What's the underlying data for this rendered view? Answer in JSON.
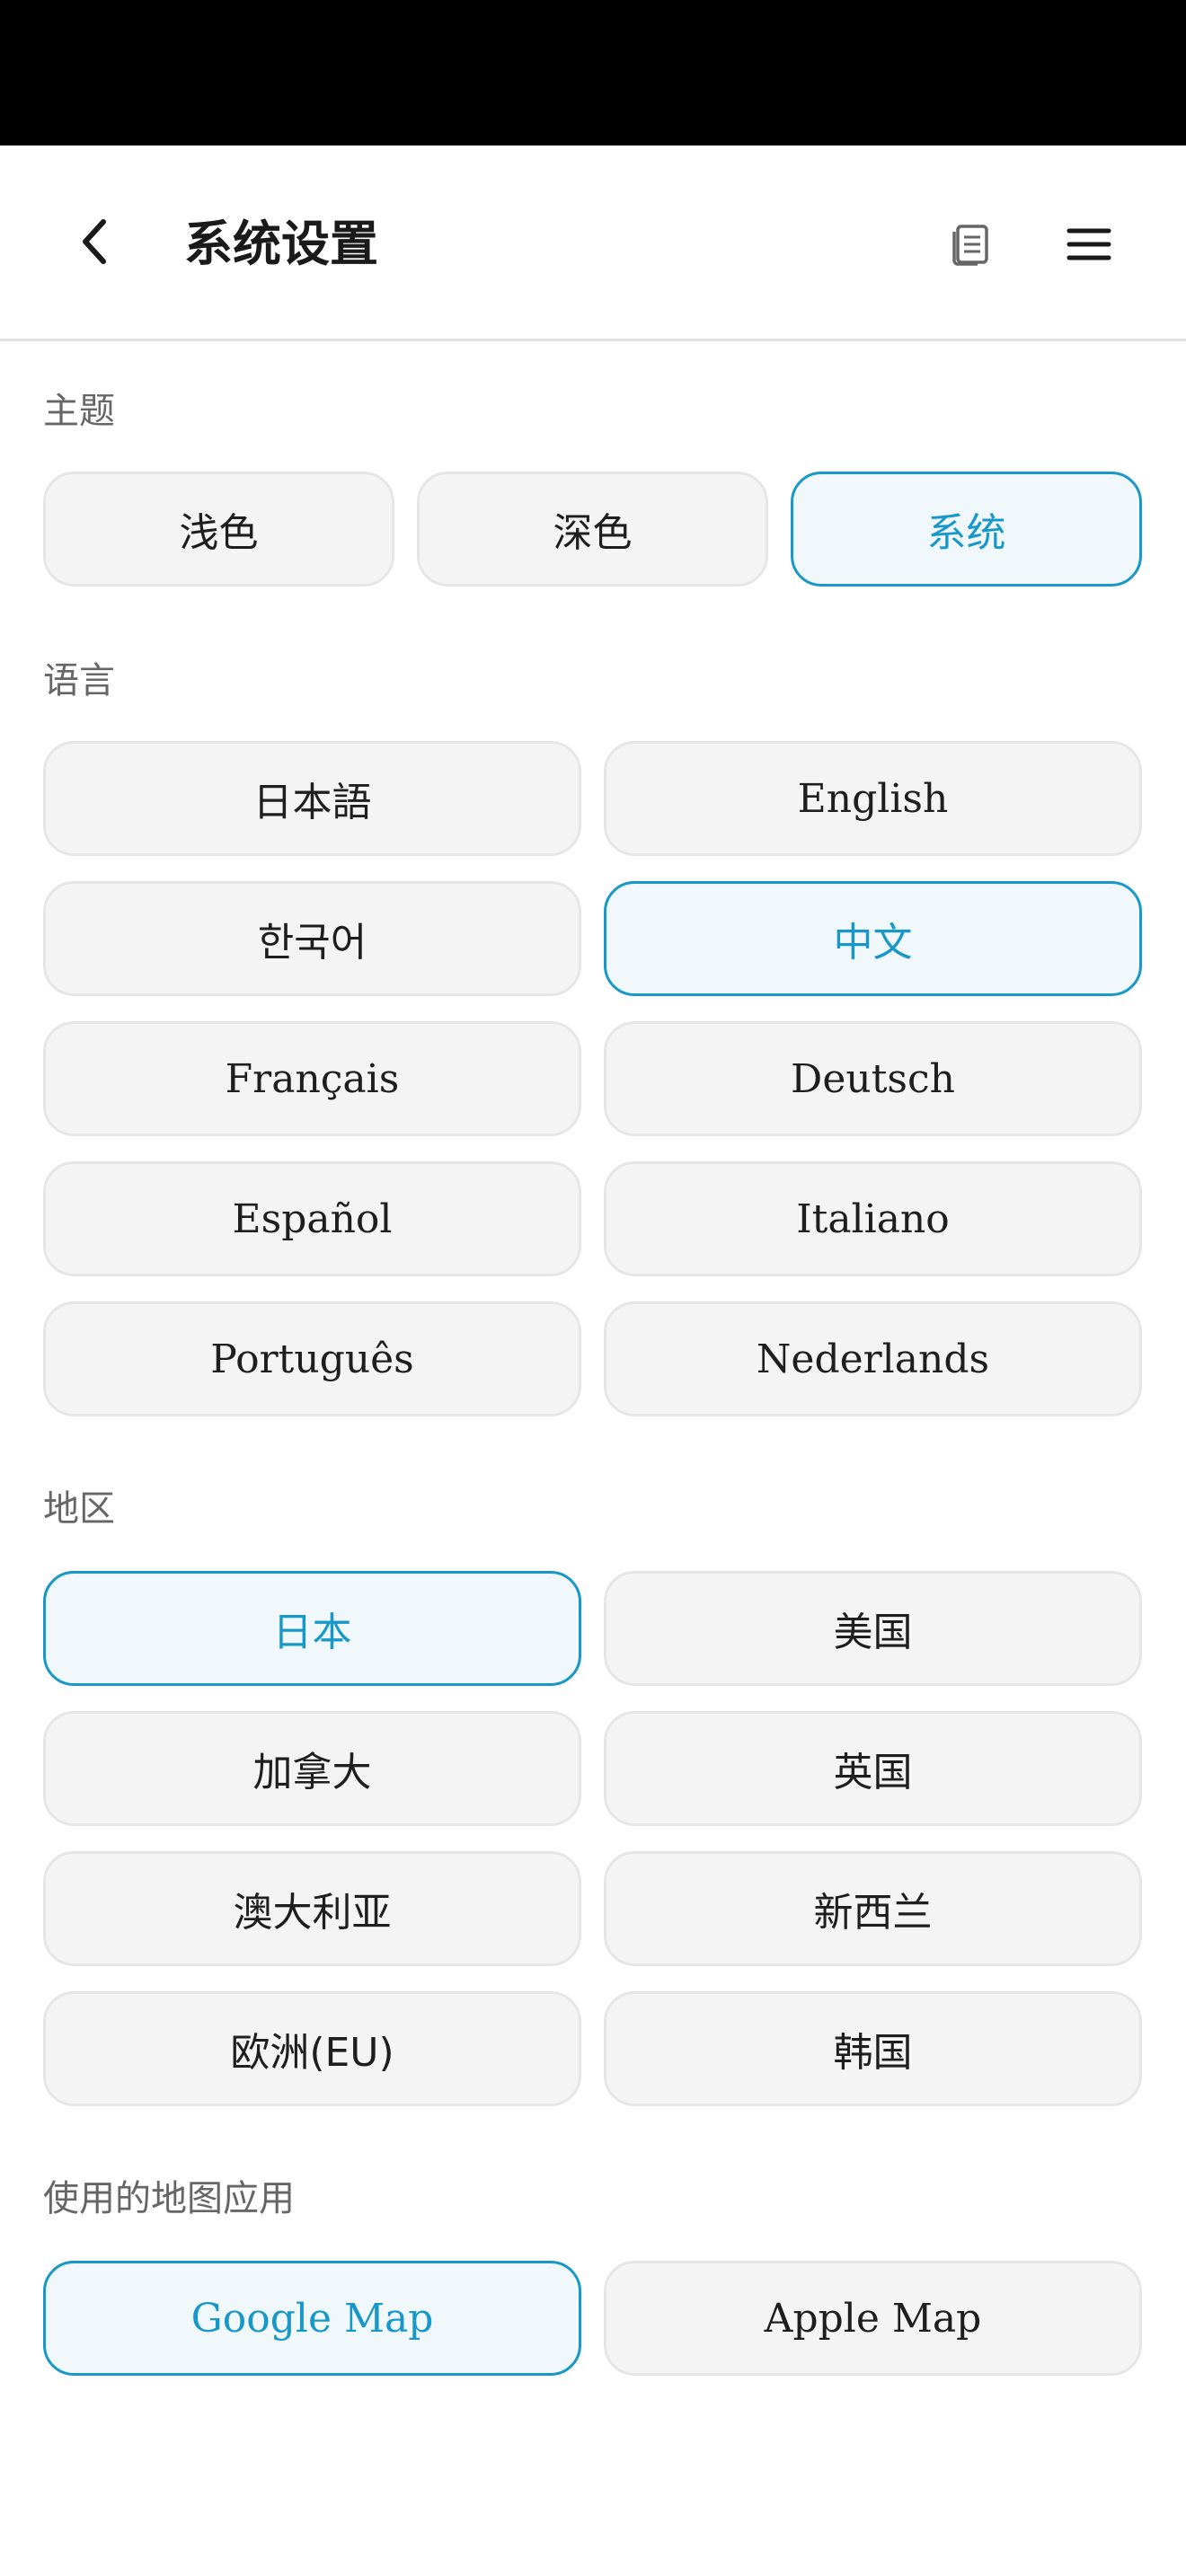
{
  "header": {
    "title": "系统设置",
    "back_icon": "chevron-left-icon",
    "doc_icon": "document-list-icon",
    "menu_icon": "hamburger-menu-icon"
  },
  "colors": {
    "accent": "#1898c8",
    "selected_bg": "#f0f8fb",
    "option_bg": "#f4f4f4",
    "option_border": "#e6e6e6",
    "status_bar": "#000000"
  },
  "theme": {
    "label": "主题",
    "options": [
      "浅色",
      "深色",
      "系统"
    ],
    "selected": "系统"
  },
  "language": {
    "label": "语言",
    "options": [
      "日本語",
      "English",
      "한국어",
      "中文",
      "Français",
      "Deutsch",
      "Español",
      "Italiano",
      "Português",
      "Nederlands"
    ],
    "selected": "中文"
  },
  "region": {
    "label": "地区",
    "options": [
      "日本",
      "美国",
      "加拿大",
      "英国",
      "澳大利亚",
      "新西兰",
      "欧洲(EU)",
      "韩国"
    ],
    "selected": "日本"
  },
  "map_app": {
    "label": "使用的地图应用",
    "options": [
      "Google Map",
      "Apple Map"
    ],
    "selected": "Google Map"
  }
}
